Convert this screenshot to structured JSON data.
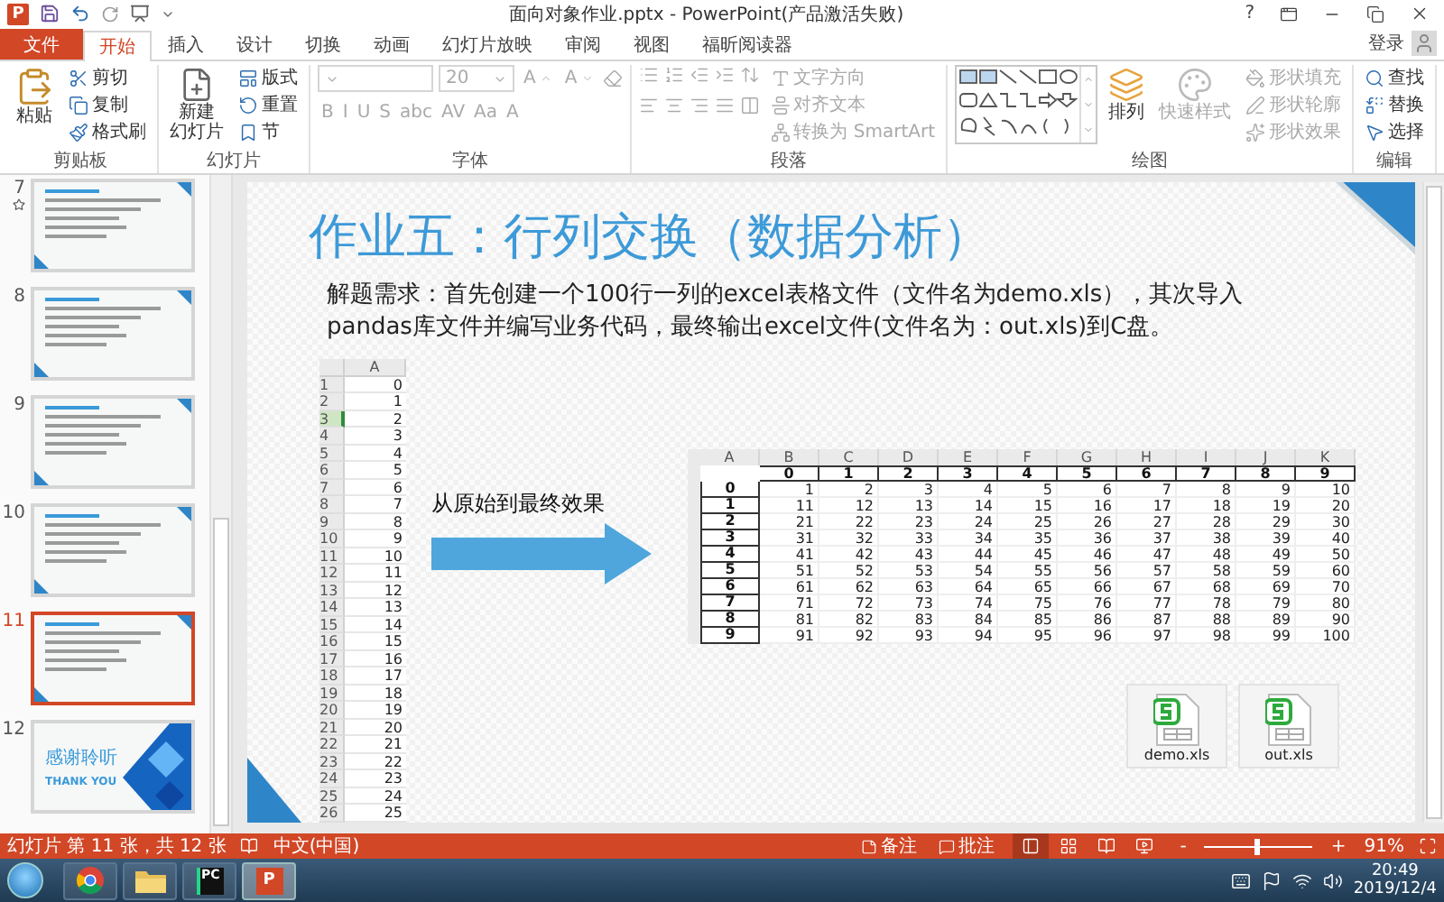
{
  "window": {
    "app_icon_label": "P",
    "title": "面向对象作业.pptx - PowerPoint(产品激活失败)",
    "help": "?"
  },
  "ribbon_tabs": [
    {
      "label": "文件",
      "kind": "file",
      "selected": false
    },
    {
      "label": "开始",
      "kind": "tab",
      "selected": true
    },
    {
      "label": "插入",
      "kind": "tab",
      "selected": false
    },
    {
      "label": "设计",
      "kind": "tab",
      "selected": false
    },
    {
      "label": "切换",
      "kind": "tab",
      "selected": false
    },
    {
      "label": "动画",
      "kind": "tab",
      "selected": false
    },
    {
      "label": "幻灯片放映",
      "kind": "tab",
      "selected": false
    },
    {
      "label": "审阅",
      "kind": "tab",
      "selected": false
    },
    {
      "label": "视图",
      "kind": "tab",
      "selected": false
    },
    {
      "label": "福昕阅读器",
      "kind": "tab",
      "selected": false
    }
  ],
  "account": {
    "label": "登录"
  },
  "clipboard": {
    "label": "剪贴板",
    "paste": "粘贴",
    "items": [
      {
        "kind": "cut",
        "label": "剪切"
      },
      {
        "kind": "copy",
        "label": "复制"
      },
      {
        "kind": "format-painter",
        "label": "格式刷"
      }
    ]
  },
  "slides_group": {
    "label": "幻灯片",
    "new_slide": [
      "新建",
      "幻灯片"
    ],
    "items": [
      {
        "kind": "layout",
        "label": "版式"
      },
      {
        "kind": "reset",
        "label": "重置"
      },
      {
        "kind": "section",
        "label": "节"
      }
    ]
  },
  "font": {
    "label": "字体",
    "disabled": true,
    "font_size": "20",
    "size_buttons": [
      "A",
      "A"
    ],
    "buttons": [
      "B",
      "I",
      "U",
      "S",
      "abc",
      "AV",
      "Aa",
      "A"
    ]
  },
  "paragraph": {
    "label": "段落",
    "disabled": true,
    "items": [
      {
        "kind": "text-direction",
        "label": "文字方向"
      },
      {
        "kind": "align-text",
        "label": "对齐文本"
      },
      {
        "kind": "smartart",
        "label": "转换为 SmartArt"
      }
    ]
  },
  "drawing": {
    "label": "绘图",
    "arrange": "排列",
    "quick_styles": {
      "label": "快速样式",
      "disabled": true
    },
    "shape_menu": [
      {
        "kind": "fill",
        "label": "形状填充",
        "disabled": true
      },
      {
        "kind": "outline",
        "label": "形状轮廓",
        "disabled": true
      },
      {
        "kind": "effects",
        "label": "形状效果",
        "disabled": true
      }
    ]
  },
  "editing": {
    "label": "编辑",
    "items": [
      {
        "kind": "find",
        "label": "查找"
      },
      {
        "kind": "replace",
        "label": "替换"
      },
      {
        "kind": "select",
        "label": "选择"
      }
    ]
  },
  "thumbnails": [
    {
      "number": "7",
      "kind": "content",
      "selected": false,
      "starred": true
    },
    {
      "number": "8",
      "kind": "content",
      "selected": false,
      "starred": false
    },
    {
      "number": "9",
      "kind": "content",
      "selected": false,
      "starred": false
    },
    {
      "number": "10",
      "kind": "content",
      "selected": false,
      "starred": false
    },
    {
      "number": "11",
      "kind": "content",
      "selected": true,
      "starred": false
    },
    {
      "number": "12",
      "kind": "thanks",
      "selected": false,
      "starred": false,
      "title": "感谢聆听",
      "subtitle": "THANK YOU"
    }
  ],
  "slide": {
    "title": "作业五：行列交换（数据分析）",
    "description": "解题需求：首先创建一个100行一列的excel表格文件（文件名为demo.xls），其次导入pandas库文件并编写业务代码，最终输出excel文件(文件名为：out.xls)到C盘。",
    "source_sheet": {
      "column": "A",
      "rows": [
        {
          "number": "1",
          "value": "0",
          "selected": false
        },
        {
          "number": "2",
          "value": "1",
          "selected": false
        },
        {
          "number": "3",
          "value": "2",
          "selected": true
        },
        {
          "number": "4",
          "value": "3",
          "selected": false
        },
        {
          "number": "5",
          "value": "4",
          "selected": false
        },
        {
          "number": "6",
          "value": "5",
          "selected": false
        },
        {
          "number": "7",
          "value": "6",
          "selected": false
        },
        {
          "number": "8",
          "value": "7",
          "selected": false
        },
        {
          "number": "9",
          "value": "8",
          "selected": false
        },
        {
          "number": "10",
          "value": "9",
          "selected": false
        },
        {
          "number": "11",
          "value": "10",
          "selected": false
        },
        {
          "number": "12",
          "value": "11",
          "selected": false
        },
        {
          "number": "13",
          "value": "12",
          "selected": false
        },
        {
          "number": "14",
          "value": "13",
          "selected": false
        },
        {
          "number": "15",
          "value": "14",
          "selected": false
        },
        {
          "number": "16",
          "value": "15",
          "selected": false
        },
        {
          "number": "17",
          "value": "16",
          "selected": false
        },
        {
          "number": "18",
          "value": "17",
          "selected": false
        },
        {
          "number": "19",
          "value": "18",
          "selected": false
        },
        {
          "number": "20",
          "value": "19",
          "selected": false
        },
        {
          "number": "21",
          "value": "20",
          "selected": false
        },
        {
          "number": "22",
          "value": "21",
          "selected": false
        },
        {
          "number": "23",
          "value": "22",
          "selected": false
        },
        {
          "number": "24",
          "value": "23",
          "selected": false
        },
        {
          "number": "25",
          "value": "24",
          "selected": false
        },
        {
          "number": "26",
          "value": "25",
          "selected": false
        }
      ]
    },
    "arrow_label": "从原始到最终效果",
    "result_sheet": {
      "columns": [
        "A",
        "B",
        "C",
        "D",
        "E",
        "F",
        "G",
        "H",
        "I",
        "J",
        "K"
      ],
      "header": [
        "0",
        "1",
        "2",
        "3",
        "4",
        "5",
        "6",
        "7",
        "8",
        "9"
      ],
      "rows": [
        {
          "label": "0",
          "values": [
            "1",
            "2",
            "3",
            "4",
            "5",
            "6",
            "7",
            "8",
            "9",
            "10"
          ]
        },
        {
          "label": "1",
          "values": [
            "11",
            "12",
            "13",
            "14",
            "15",
            "16",
            "17",
            "18",
            "19",
            "20"
          ]
        },
        {
          "label": "2",
          "values": [
            "21",
            "22",
            "23",
            "24",
            "25",
            "26",
            "27",
            "28",
            "29",
            "30"
          ]
        },
        {
          "label": "3",
          "values": [
            "31",
            "32",
            "33",
            "34",
            "35",
            "36",
            "37",
            "38",
            "39",
            "40"
          ]
        },
        {
          "label": "4",
          "values": [
            "41",
            "42",
            "43",
            "44",
            "45",
            "46",
            "47",
            "48",
            "49",
            "50"
          ]
        },
        {
          "label": "5",
          "values": [
            "51",
            "52",
            "53",
            "54",
            "55",
            "56",
            "57",
            "58",
            "59",
            "60"
          ]
        },
        {
          "label": "6",
          "values": [
            "61",
            "62",
            "63",
            "64",
            "65",
            "66",
            "67",
            "68",
            "69",
            "70"
          ]
        },
        {
          "label": "7",
          "values": [
            "71",
            "72",
            "73",
            "74",
            "75",
            "76",
            "77",
            "78",
            "79",
            "80"
          ]
        },
        {
          "label": "8",
          "values": [
            "81",
            "82",
            "83",
            "84",
            "85",
            "86",
            "87",
            "88",
            "89",
            "90"
          ]
        },
        {
          "label": "9",
          "values": [
            "91",
            "92",
            "93",
            "94",
            "95",
            "96",
            "97",
            "98",
            "99",
            "100"
          ]
        }
      ]
    },
    "files": [
      {
        "name": "demo.xls"
      },
      {
        "name": "out.xls"
      }
    ]
  },
  "status_bar": {
    "slide_info": "幻灯片 第 11 张，共 12 张",
    "language": "中文(中国)",
    "notes": "备注",
    "comments": "批注",
    "views": [
      {
        "kind": "normal",
        "selected": true
      },
      {
        "kind": "sorter",
        "selected": false
      },
      {
        "kind": "reading",
        "selected": false
      },
      {
        "kind": "slideshow",
        "selected": false
      }
    ],
    "zoom": {
      "minus": "-",
      "plus": "+",
      "level": 0.48,
      "reading": "91%"
    }
  },
  "taskbar": {
    "apps": [
      {
        "kind": "chrome",
        "selected": false
      },
      {
        "kind": "explorer",
        "selected": false
      },
      {
        "kind": "pycharm",
        "label": "PC",
        "selected": false
      },
      {
        "kind": "powerpoint",
        "label": "P",
        "selected": true
      }
    ],
    "time": "20:49",
    "date": "2019/12/4"
  }
}
